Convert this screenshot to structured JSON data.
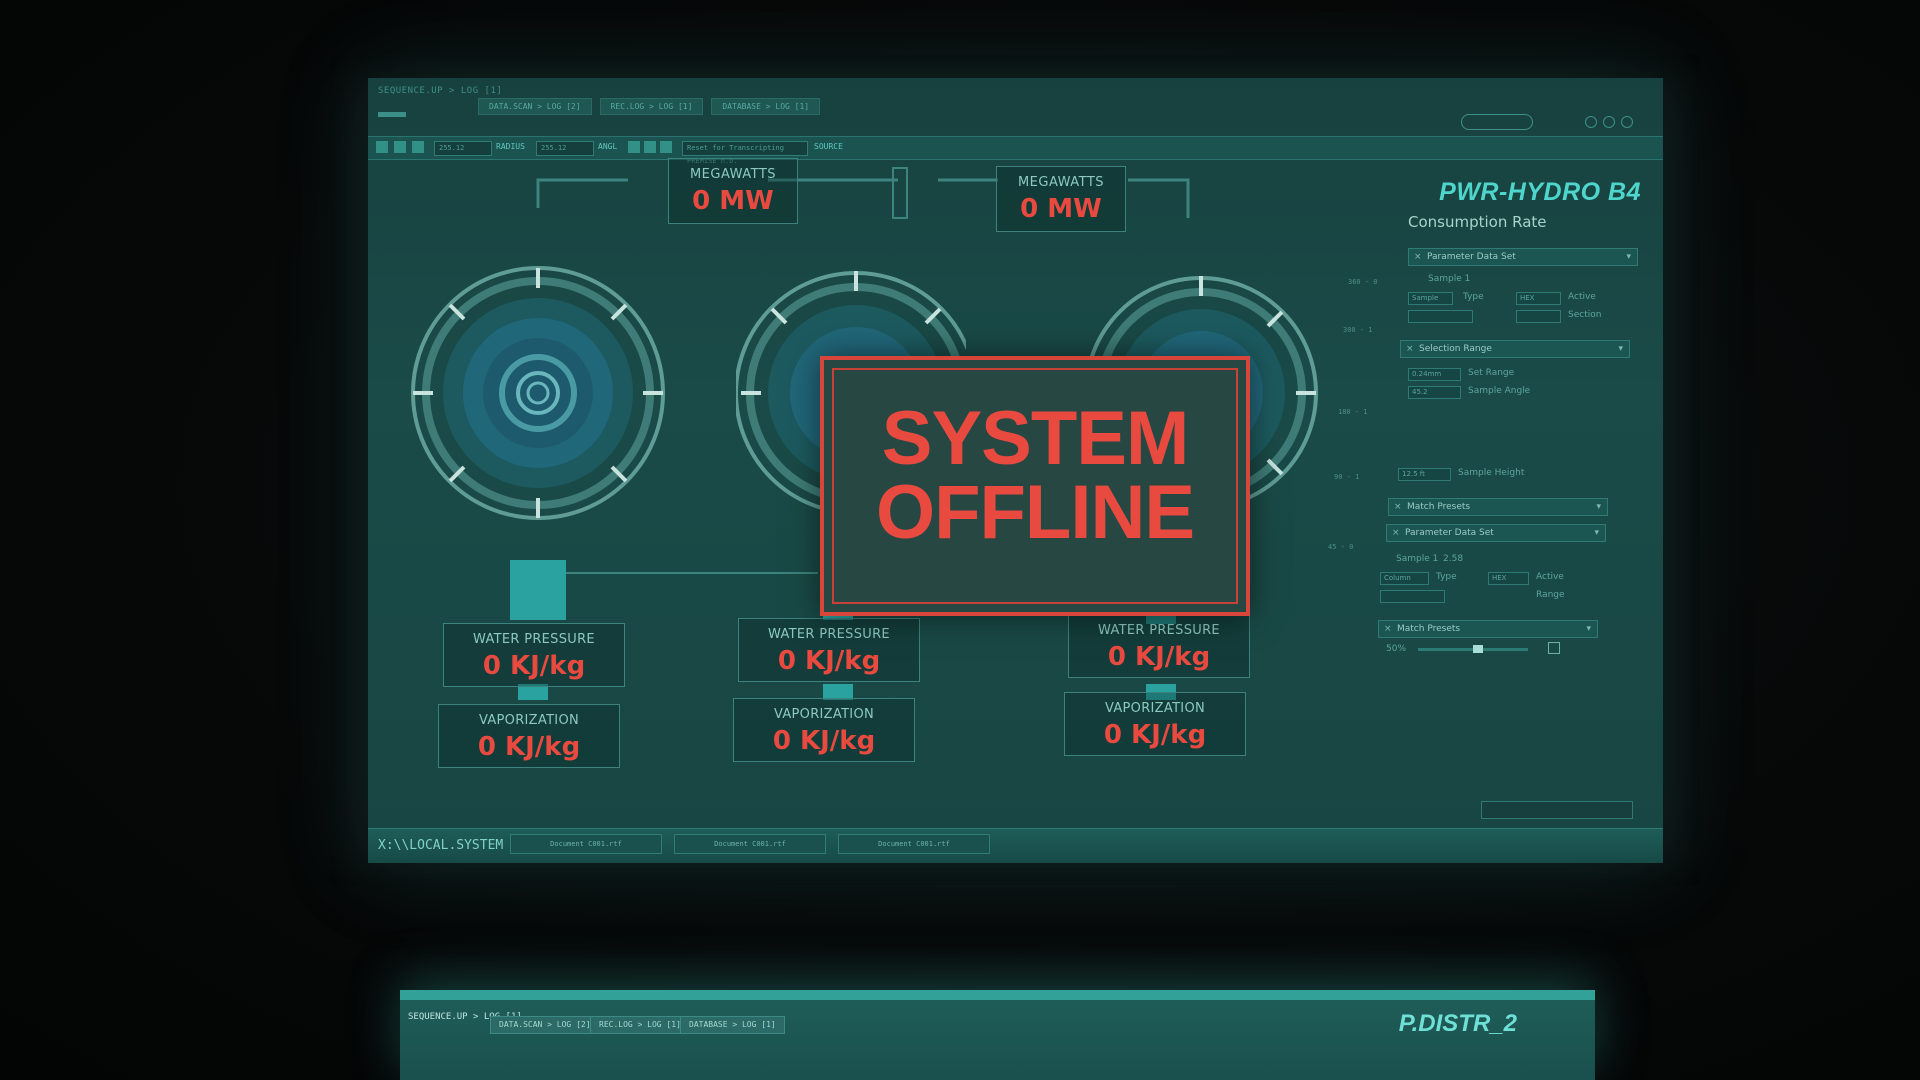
{
  "window": {
    "sequence_label": "SEQUENCE.UP > LOG [1]",
    "tabs": [
      "DATA.SCAN > LOG [2]",
      "REC.LOG > LOG [1]",
      "DATABASE > LOG [1]"
    ],
    "toolbar": {
      "field1": "255.12",
      "radius_label": "RADIUS",
      "field2": "255.12",
      "angle_label": "ANGL",
      "search_placeholder": "Reset for Transcripting PREMISE n.b.",
      "source_label": "SOURCE"
    }
  },
  "brand": "PWR-HYDRO B4",
  "megawatts": [
    {
      "label": "MEGAWATTS",
      "value": "0 MW"
    },
    {
      "label": "MEGAWATTS",
      "value": "0 MW"
    }
  ],
  "units": [
    {
      "pressure_label": "WATER PRESSURE",
      "pressure_value": "0 KJ/kg",
      "vapor_label": "VAPORIZATION",
      "vapor_value": "0 KJ/kg"
    },
    {
      "pressure_label": "WATER PRESSURE",
      "pressure_value": "0 KJ/kg",
      "vapor_label": "VAPORIZATION",
      "vapor_value": "0 KJ/kg"
    },
    {
      "pressure_label": "WATER PRESSURE",
      "pressure_value": "0 KJ/kg",
      "vapor_label": "VAPORIZATION",
      "vapor_value": "0 KJ/kg"
    }
  ],
  "alert": {
    "line1": "SYSTEM",
    "line2": "OFFLINE"
  },
  "side_panel": {
    "title": "Consumption Rate",
    "sections": {
      "param1": "Parameter Data Set",
      "selection": "Selection Range",
      "match1": "Match Presets",
      "param2": "Parameter Data Set",
      "match2": "Match Presets"
    },
    "labels": {
      "sample1": "Sample 1",
      "type": "Type",
      "active": "Active",
      "section": "Section",
      "set_range": "Set Range",
      "sample_angle": "Sample Angle",
      "sample_height": "Sample Height",
      "sample1b": "Sample 1",
      "type2": "Type",
      "active2": "Active",
      "range": "Range"
    },
    "values": {
      "sample": "Sample",
      "hex": "HEX",
      "val_a": "0.24mm",
      "val_b": "45.2",
      "val_c": "12.5 ft",
      "sample1b_val": "2.58",
      "column": "Column",
      "hex2": "HEX",
      "percent": "50%"
    }
  },
  "bottom": {
    "path": "X:\\\\LOCAL.SYSTEM",
    "doc_tabs": [
      "Document C001.rtf",
      "Document C001.rtf",
      "Document C001.rtf"
    ]
  },
  "lower_monitor": {
    "sequence_label": "SEQUENCE.UP > LOG [1]",
    "tabs": [
      "DATA.SCAN > LOG [2]",
      "REC.LOG > LOG [1]",
      "DATABASE > LOG [1]"
    ],
    "brand": "P.DISTR_2"
  },
  "colors": {
    "screen_bg": "#1a4b48",
    "alert_red": "#e94a3f",
    "accent_cyan": "#4fd6cc"
  }
}
